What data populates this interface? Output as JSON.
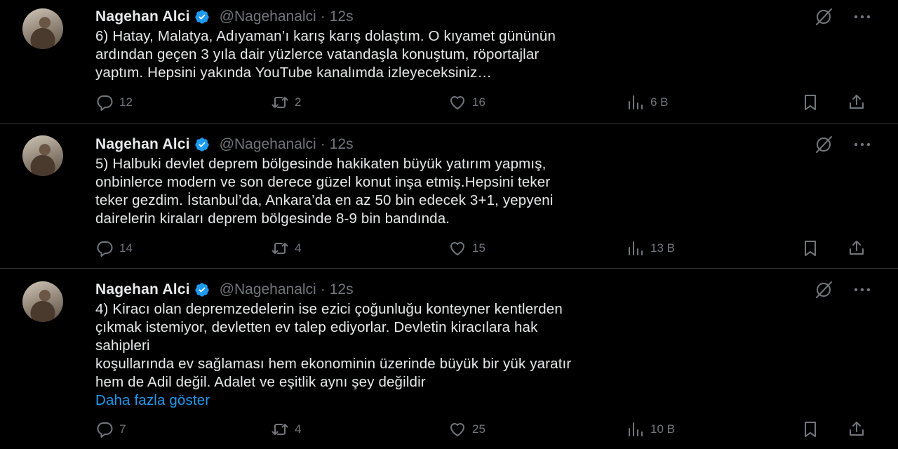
{
  "colors": {
    "background": "#000000",
    "text": "#e7e9ea",
    "muted": "#71767b",
    "link": "#1d9bf0",
    "verified": "#1d9bf0",
    "divider": "#2f3336"
  },
  "tweets": [
    {
      "author": "Nagehan Alci",
      "handle": "@Nagehanalci",
      "time": "12s",
      "lines": [
        "6) Hatay, Malatya, Adıyaman’ı karış karış dolaştım. O kıyamet gününün",
        "ardından geçen 3 yıla dair yüzlerce vatandaşla konuştum, röportajlar",
        "yaptım. Hepsini yakında YouTube kanalımda izleyeceksiniz…"
      ],
      "show_more": "",
      "replies": "12",
      "retweets": "2",
      "likes": "16",
      "views": "6 B"
    },
    {
      "author": "Nagehan Alci",
      "handle": "@Nagehanalci",
      "time": "12s",
      "lines": [
        "5) Halbuki devlet deprem bölgesinde hakikaten büyük yatırım yapmış,",
        "onbinlerce modern ve son derece güzel konut inşa etmiş.Hepsini teker",
        "teker gezdim. İstanbul’da, Ankara’da en az 50 bin edecek 3+1, yepyeni",
        "dairelerin kiraları deprem bölgesinde 8-9 bin bandında."
      ],
      "show_more": "",
      "replies": "14",
      "retweets": "4",
      "likes": "15",
      "views": "13 B"
    },
    {
      "author": "Nagehan Alci",
      "handle": "@Nagehanalci",
      "time": "12s",
      "lines": [
        "4) Kiracı olan depremzedelerin ise ezici çoğunluğu konteyner kentlerden",
        "çıkmak istemiyor, devletten ev talep ediyorlar. Devletin kiracılara hak",
        "sahipleri",
        "koşullarında ev sağlaması hem ekonominin üzerinde büyük bir yük yaratır",
        "hem de Adil değil. Adalet ve eşitlik aynı şey değildir"
      ],
      "show_more": "Daha fazla göster",
      "replies": "7",
      "retweets": "4",
      "likes": "25",
      "views": "10 B"
    }
  ]
}
